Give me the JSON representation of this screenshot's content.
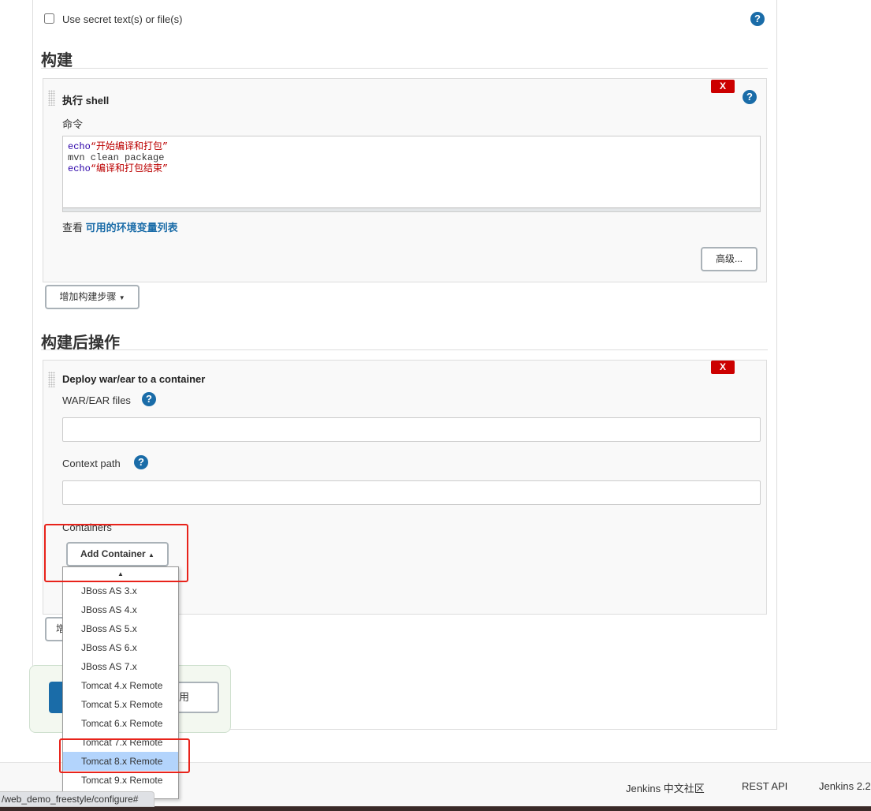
{
  "credentials": {
    "checkbox_label": "Use secret text(s) or file(s)",
    "checked": false
  },
  "build": {
    "heading": "构建",
    "step": {
      "title": "执行 shell",
      "delete_label": "X",
      "command_label": "命令",
      "command_lines": [
        {
          "kw": "echo",
          "str": "“开始编译和打包”"
        },
        {
          "plain": "mvn clean package"
        },
        {
          "kw": "echo",
          "str": "“编译和打包结束”"
        }
      ],
      "env_prefix": "查看",
      "env_link": "可用的环境变量列表",
      "advanced_button": "高级..."
    },
    "add_step_button": "增加构建步骤"
  },
  "post_build": {
    "heading": "构建后操作",
    "step": {
      "title": "Deploy war/ear to a container",
      "delete_label": "X",
      "war_label": "WAR/EAR files",
      "war_value": "",
      "context_label": "Context path",
      "context_value": "",
      "containers_label": "Containers",
      "add_container_button": "Add Container",
      "menu_items": [
        "JBoss AS 3.x",
        "JBoss AS 4.x",
        "JBoss AS 5.x",
        "JBoss AS 6.x",
        "JBoss AS 7.x",
        "Tomcat 4.x Remote",
        "Tomcat 5.x Remote",
        "Tomcat 6.x Remote",
        "Tomcat 7.x Remote",
        "Tomcat 8.x Remote",
        "Tomcat 9.x Remote"
      ],
      "selected_item": "Tomcat 8.x Remote"
    },
    "add_step_partial": "增"
  },
  "actions": {
    "apply_partial": "用"
  },
  "footer": {
    "community": "Jenkins 中文社区",
    "rest_api": "REST API",
    "version": "Jenkins 2.2"
  },
  "status_url": "/web_demo_freestyle/configure#",
  "colors": {
    "help": "#1a6ca8",
    "delete": "#cc0000",
    "highlight": "#e8231b",
    "selected": "#b3d4fc",
    "save": "#1a6ca8"
  }
}
